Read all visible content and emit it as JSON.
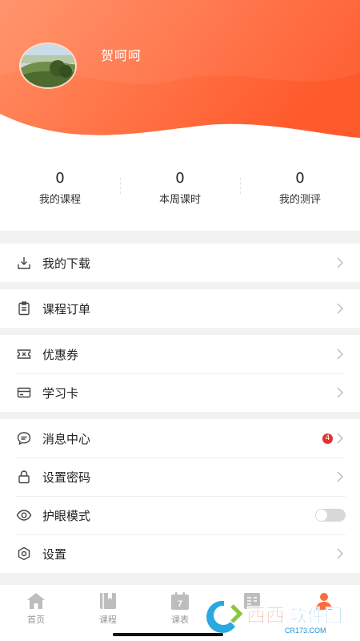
{
  "profile": {
    "username": "贺呵呵"
  },
  "stats": [
    {
      "value": "0",
      "label": "我的课程"
    },
    {
      "value": "0",
      "label": "本周课时"
    },
    {
      "value": "0",
      "label": "我的测评"
    }
  ],
  "menu": {
    "downloads": "我的下载",
    "orders": "课程订单",
    "coupons": "优惠券",
    "study_card": "学习卡",
    "messages": "消息中心",
    "messages_badge": "4",
    "password": "设置密码",
    "eye_mode": "护眼模式",
    "eye_mode_on": false,
    "settings": "设置"
  },
  "tabbar": {
    "home": "首页",
    "course": "课程",
    "schedule": "课表",
    "schedule_day": "7",
    "active_tab": "profile"
  },
  "watermark": {
    "brand": "西西软件园",
    "url": "CR173.COM"
  },
  "colors": {
    "accent": "#ff6a3c",
    "gradient_start": "#ff8a5c",
    "gradient_end": "#ff5a2e",
    "badge": "#e0332c"
  }
}
